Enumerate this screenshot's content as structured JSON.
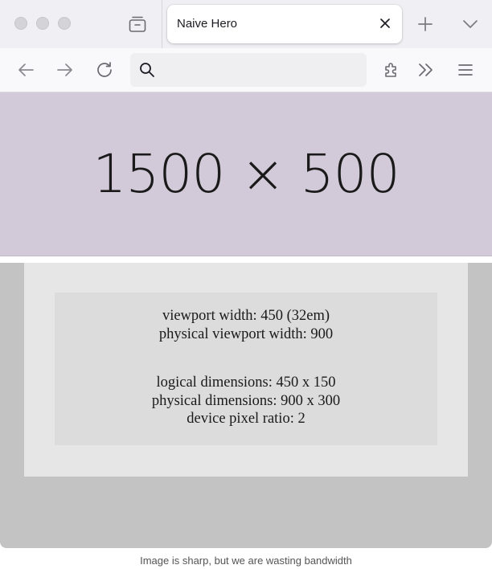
{
  "browser": {
    "tab": {
      "title": "Naive Hero"
    },
    "urlbar": {
      "value": "",
      "placeholder": ""
    },
    "icons": [
      "close-icon",
      "plus-icon",
      "chevron-down-icon",
      "back-arrow-icon",
      "forward-arrow-icon",
      "reload-icon",
      "search-icon",
      "extensions-icon",
      "overflow-chevrons-icon",
      "hamburger-menu-icon",
      "tab-stack-icon"
    ]
  },
  "page": {
    "hero_label": "1500 × 500",
    "hero_color": "#d3cad9",
    "info": {
      "viewport_width": "viewport width: 450 (32em)",
      "physical_viewport_width": "physical viewport width: 900",
      "logical_dimensions": "logical dimensions: 450 x 150",
      "physical_dimensions": "physical dimensions: 900 x 300",
      "device_pixel_ratio": "device pixel ratio: 2"
    }
  },
  "caption": "Image is sharp, but we are wasting bandwidth"
}
